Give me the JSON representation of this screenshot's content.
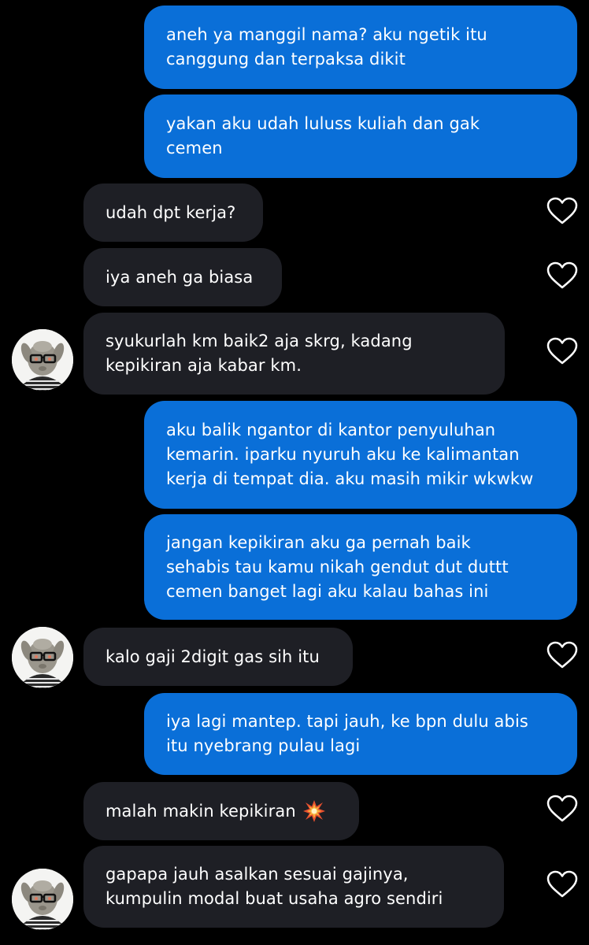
{
  "messages": [
    {
      "text": "aneh ya manggil nama? aku ngetik itu\ncanggung dan terpaksa dikit"
    },
    {
      "text": "yakan aku udah luluss kuliah dan gak\ncemen"
    },
    {
      "text": "udah dpt kerja?"
    },
    {
      "text": "iya aneh ga biasa"
    },
    {
      "text": "syukurlah km baik2 aja skrg, kadang\nkepikiran aja kabar km."
    },
    {
      "text": "aku balik ngantor di kantor penyuluhan\nkemarin. iparku nyuruh aku ke kalimantan\nkerja di tempat dia. aku masih mikir wkwkw"
    },
    {
      "text": "jangan kepikiran aku ga pernah baik\nsehabis tau kamu nikah gendut dut duttt\ncemen banget lagi aku kalau bahas ini"
    },
    {
      "text": "kalo gaji 2digit gas sih itu"
    },
    {
      "text": "iya lagi mantep. tapi jauh, ke bpn dulu abis\nitu nyebrang pulau lagi"
    },
    {
      "text": "malah makin kepikiran",
      "emoji": "collision-emoji"
    },
    {
      "text": "gapapa jauh asalkan sesuai gajinya,\nkumpulin modal buat usaha agro sendiri"
    }
  ],
  "colors": {
    "background": "#000000",
    "sent_bubble": "#0a6fd8",
    "received_bubble": "#1e1f25",
    "text": "#ffffff",
    "heart_outline": "#ffffff"
  },
  "icons": {
    "like": "heart-outline-icon",
    "avatar": "cartoon-sheep-with-glasses-avatar"
  }
}
